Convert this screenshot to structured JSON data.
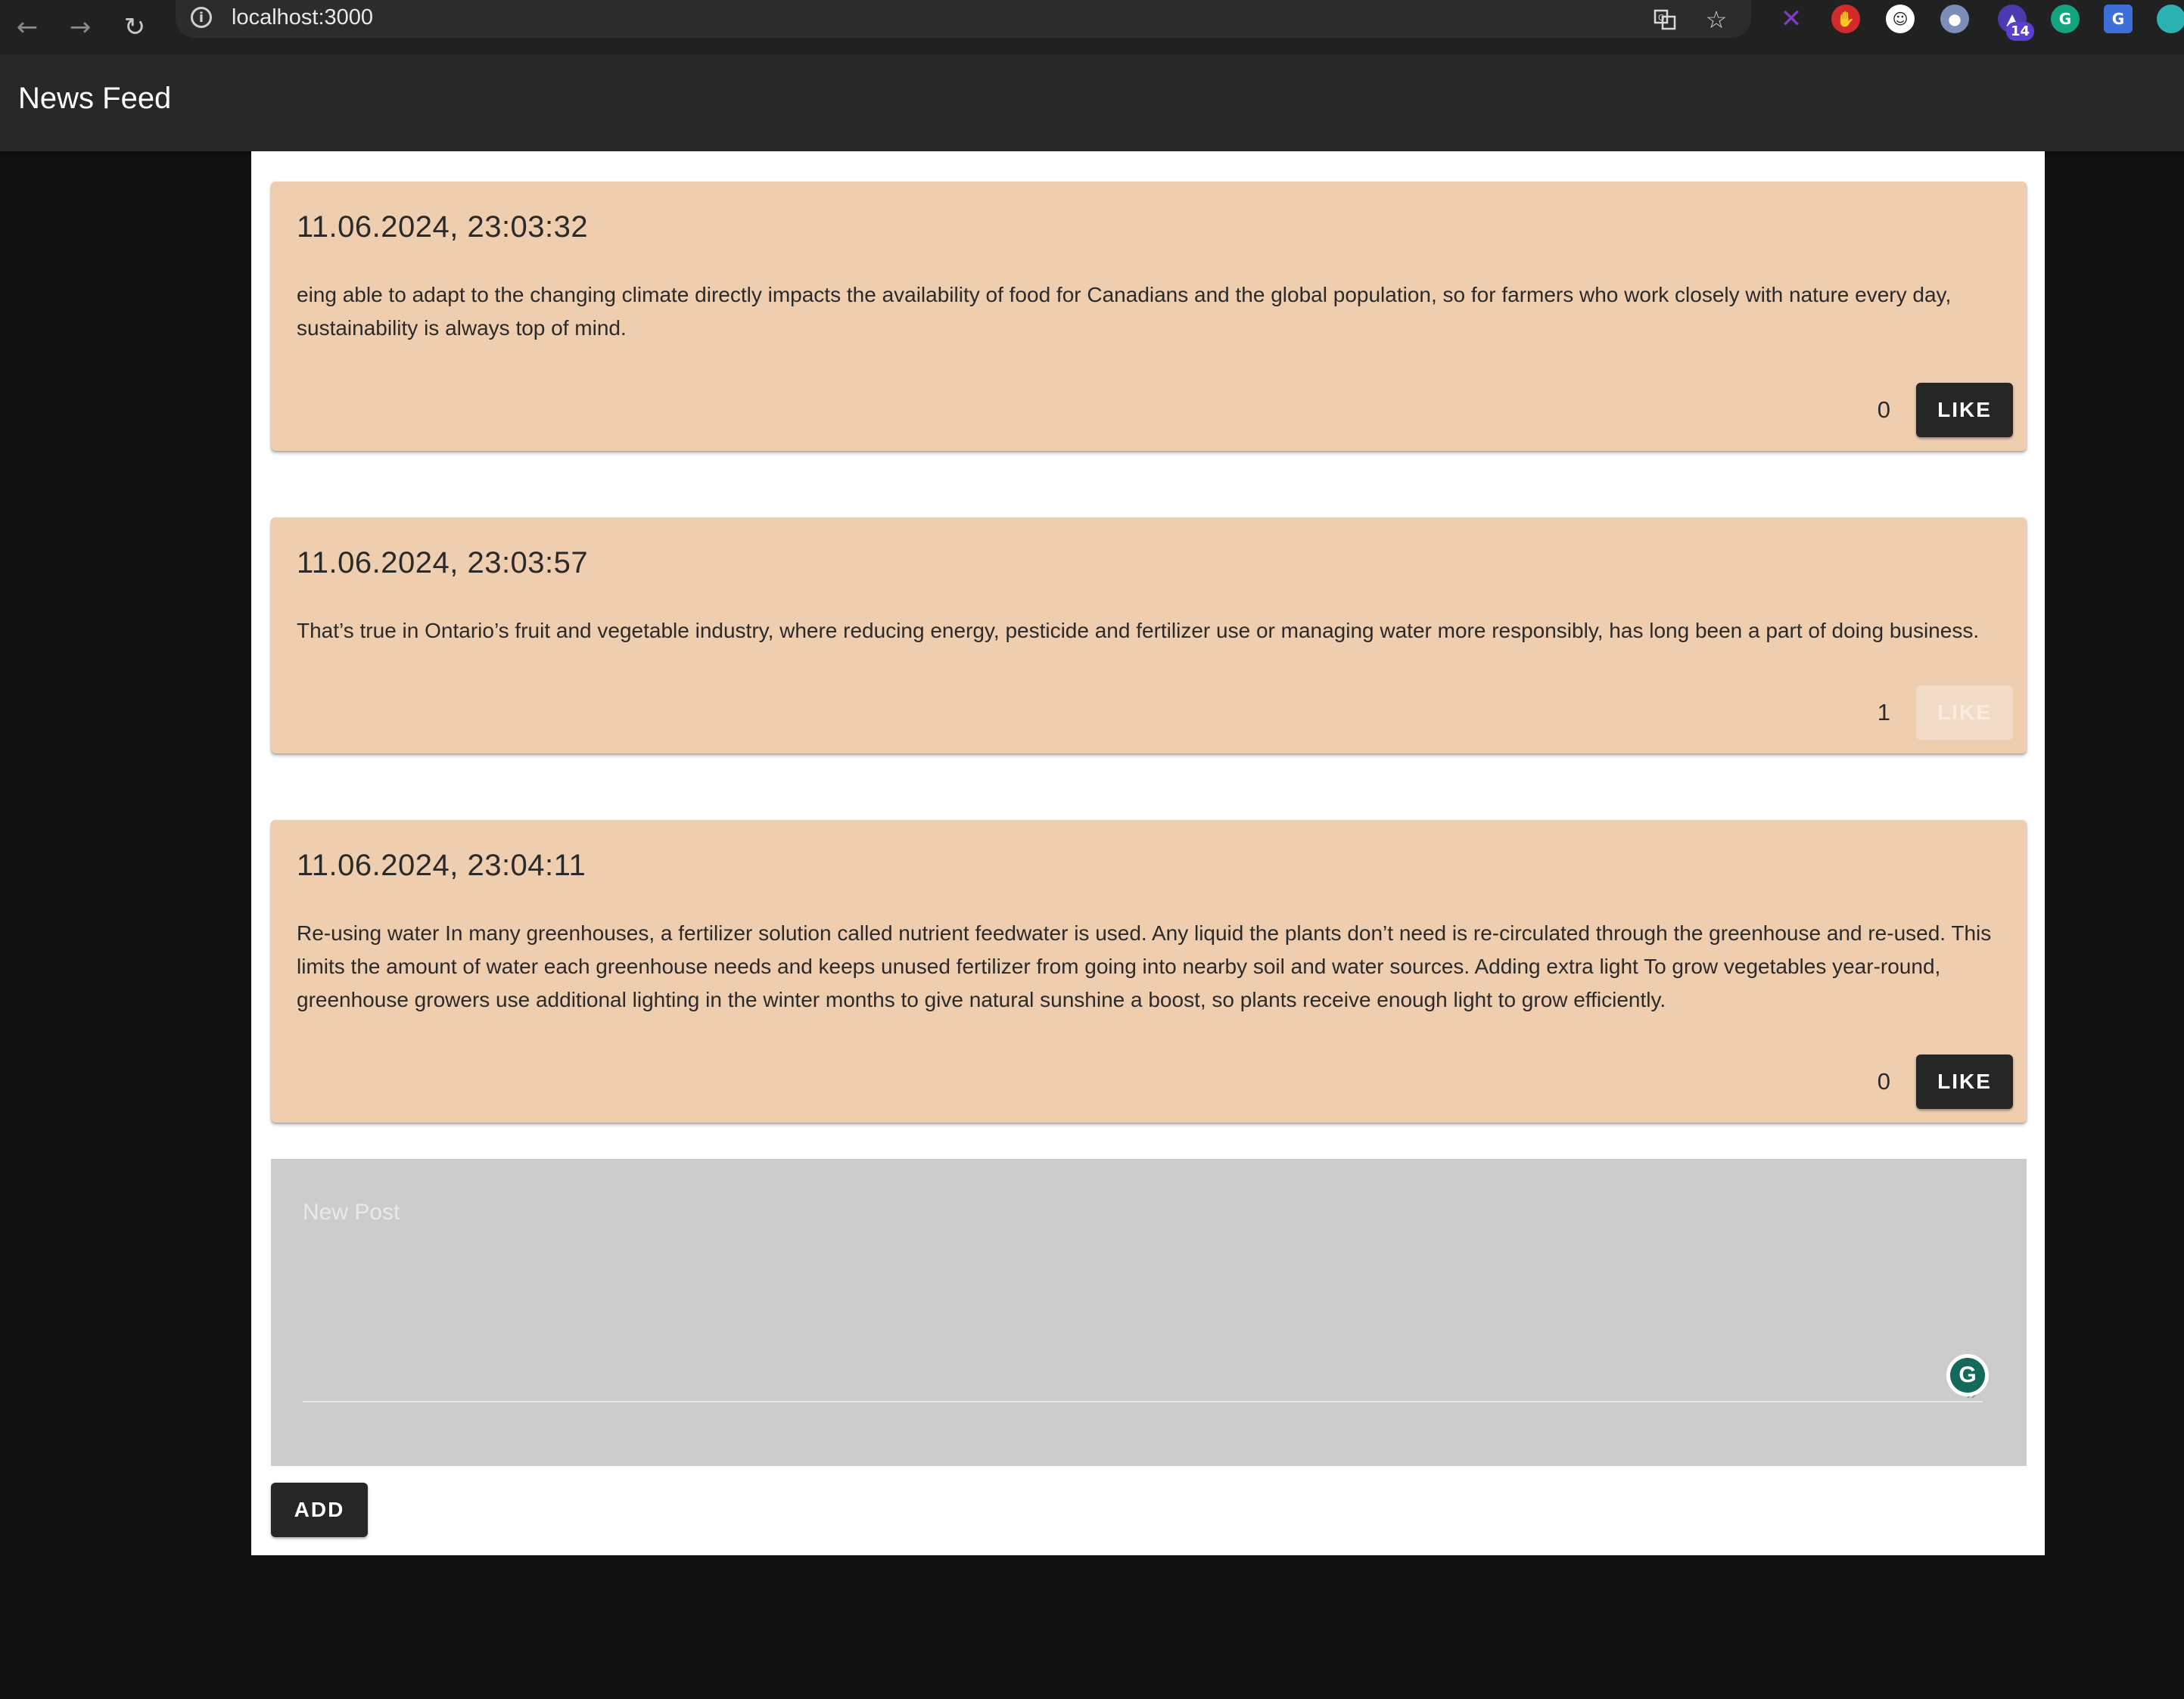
{
  "browser": {
    "url": "localhost:3000",
    "back_icon": "arrow-left",
    "forward_icon": "arrow-right",
    "reload_icon": "reload",
    "ext_badge_count": "14"
  },
  "app": {
    "title": "News Feed"
  },
  "posts": [
    {
      "date": "11.06.2024, 23:03:32",
      "text": "eing able to adapt to the changing climate directly impacts the availability of food for Canadians and the global population, so for farmers who work closely with nature every day, sustainability is always top of mind.",
      "likes": "0",
      "like_label": "LIKE",
      "like_disabled": false
    },
    {
      "date": "11.06.2024, 23:03:57",
      "text": "That’s true in Ontario’s fruit and vegetable industry, where reducing energy, pesticide and fertilizer use or managing water more responsibly, has long been a part of doing business.",
      "likes": "1",
      "like_label": "LIKE",
      "like_disabled": true
    },
    {
      "date": "11.06.2024, 23:04:11",
      "text": "Re-using water In many greenhouses, a fertilizer solution called nutrient feedwater is used. Any liquid the plants don’t need is re-circulated through the greenhouse and re-used. This limits the amount of water each greenhouse needs and keeps unused fertilizer from going into nearby soil and water sources. Adding extra light To grow vegetables year-round, greenhouse growers use additional lighting in the winter months to give natural sunshine a boost, so plants receive enough light to grow efficiently.",
      "likes": "0",
      "like_label": "LIKE",
      "like_disabled": false
    }
  ],
  "new_post": {
    "placeholder": "New Post",
    "add_label": "ADD"
  },
  "colors": {
    "card_bg": "#efceb0",
    "page_bg": "#121212",
    "appbar_bg": "#272727",
    "button_bg": "#262626"
  }
}
